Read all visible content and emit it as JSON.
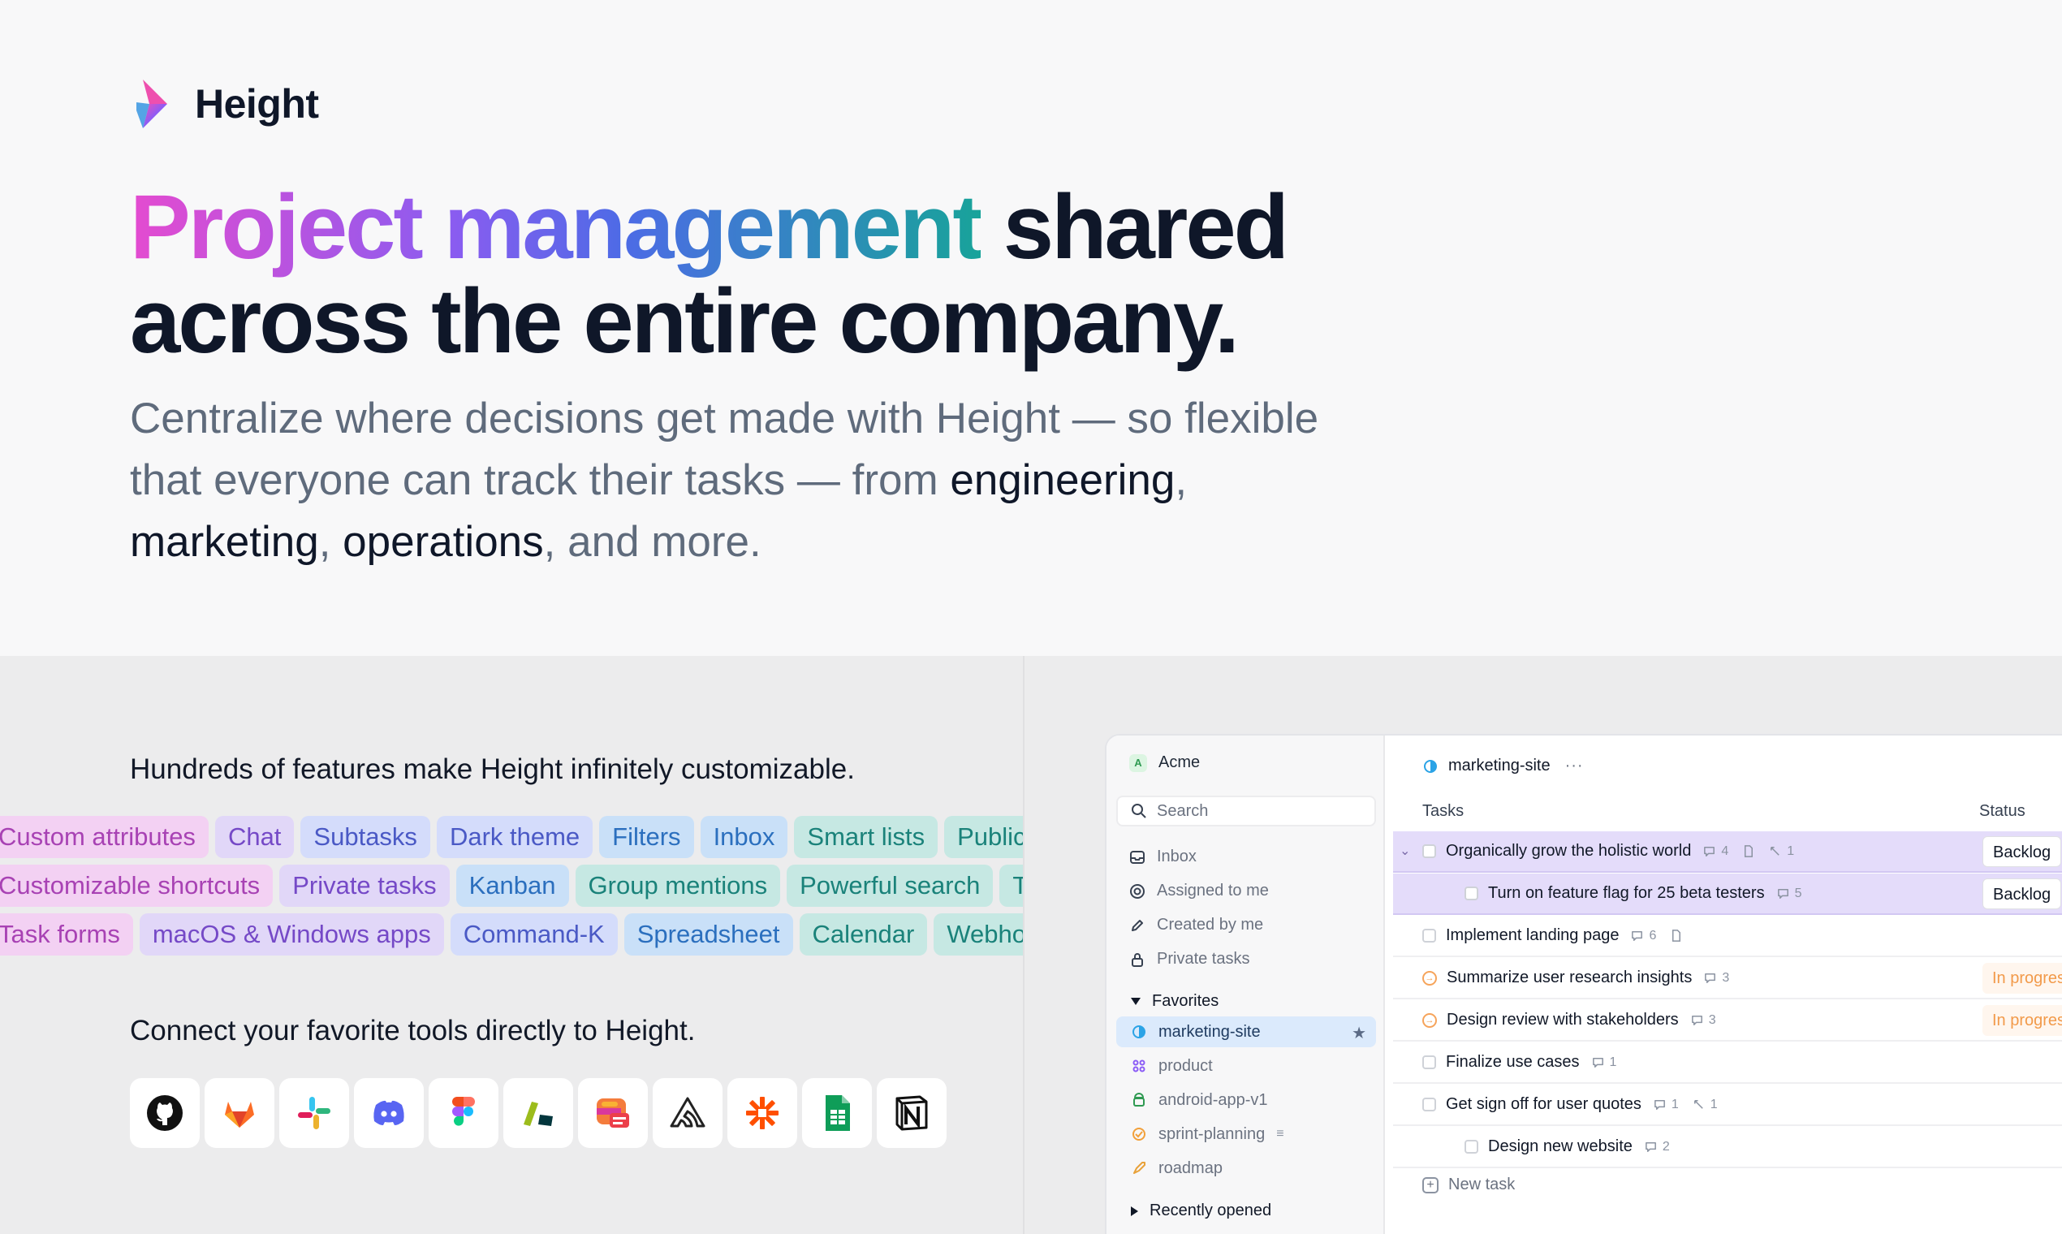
{
  "brand": {
    "name": "Height"
  },
  "hero": {
    "headline_grad": "Project management",
    "headline_rest": " shared",
    "headline_line2": "across the entire company.",
    "sub_1": "Centralize where decisions get made with Height — so flexible that everyone can track their tasks — from ",
    "sub_eng": "engineering",
    "sub_c1": ", ",
    "sub_mkt": "marketing",
    "sub_c2": ", ",
    "sub_ops": "operations",
    "sub_end": ", and more."
  },
  "features": {
    "title": "Hundreds of features make Height infinitely customizable.",
    "row1": [
      "Custom attributes",
      "Chat",
      "Subtasks",
      "Dark theme",
      "Filters",
      "Inbox",
      "Smart lists",
      "Public"
    ],
    "row2": [
      "Customizable shortcuts",
      "Private tasks",
      "Kanban",
      "Group mentions",
      "Powerful search",
      "Timeline"
    ],
    "row3": [
      "Task forms",
      "macOS & Windows apps",
      "Command-K",
      "Spreadsheet",
      "Calendar",
      "Webhooks"
    ]
  },
  "tools": {
    "title": "Connect your favorite tools directly to Height.",
    "items": [
      "github-icon",
      "gitlab-icon",
      "slack-icon",
      "discord-icon",
      "figma-icon",
      "zendesk-icon",
      "front-icon",
      "sentry-icon",
      "zapier-icon",
      "google-sheets-icon",
      "notion-icon"
    ]
  },
  "app": {
    "workspace": {
      "badge": "A",
      "name": "Acme"
    },
    "search_label": "Search",
    "nav": [
      "Inbox",
      "Assigned to me",
      "Created by me",
      "Private tasks"
    ],
    "favorites_label": "Favorites",
    "favorites": [
      "marketing-site",
      "product",
      "android-app-v1",
      "sprint-planning",
      "roadmap"
    ],
    "recent_label": "Recently opened",
    "list_title": "marketing-site",
    "list_dots": "···",
    "col_tasks": "Tasks",
    "col_status": "Status",
    "tasks": [
      {
        "label": "Organically grow the holistic world",
        "comments": "4",
        "links": "1",
        "status": "Backlog"
      },
      {
        "label": "Turn on feature flag for 25 beta testers",
        "comments": "5",
        "status": "Backlog"
      },
      {
        "label": "Implement landing page",
        "comments": "6"
      },
      {
        "label": "Summarize user research insights",
        "comments": "3",
        "status": "In progress"
      },
      {
        "label": "Design review with stakeholders",
        "comments": "3",
        "status": "In progress"
      },
      {
        "label": "Finalize use cases",
        "comments": "1"
      },
      {
        "label": "Get sign off for user quotes",
        "comments": "1",
        "links": "1"
      },
      {
        "label": "Design new website",
        "comments": "2"
      }
    ],
    "new_task_label": "New task"
  },
  "colors": {
    "accent_blue": "#dbeafc",
    "selected_row": "#e4dcfa",
    "in_progress": "#f29a4a"
  }
}
